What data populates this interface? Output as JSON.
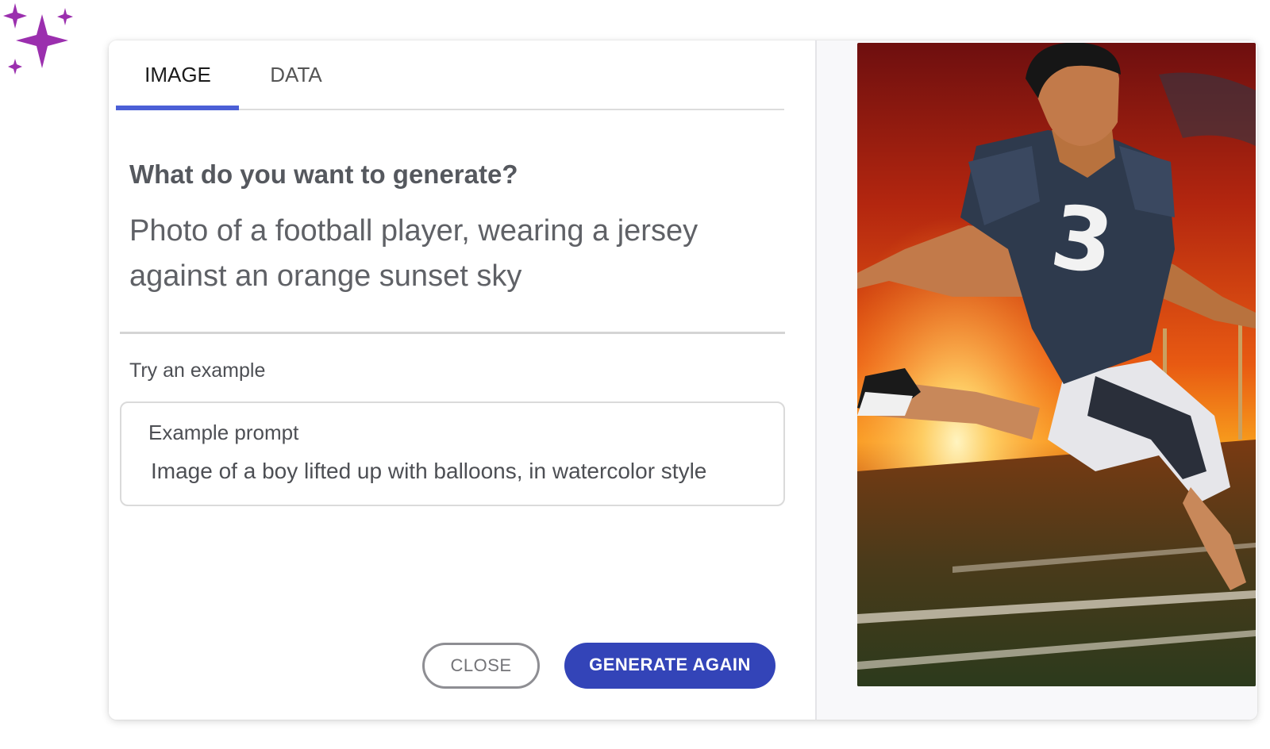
{
  "tabs": [
    {
      "label": "IMAGE",
      "active": true
    },
    {
      "label": "DATA",
      "active": false
    }
  ],
  "form": {
    "question": "What do you want to generate?",
    "prompt": "Photo of a football player, wearing a jersey against an orange sunset sky"
  },
  "examples": {
    "heading": "Try an example",
    "card_title": "Example prompt",
    "card_text": "Image of a boy lifted up with balloons, in watercolor style"
  },
  "buttons": {
    "close": "CLOSE",
    "generate": "GENERATE AGAIN"
  },
  "preview": {
    "jersey_number": "3"
  },
  "colors": {
    "accent": "#4b5fd6",
    "primary_button": "#3344b8",
    "sparkle": "#9b2fae"
  }
}
